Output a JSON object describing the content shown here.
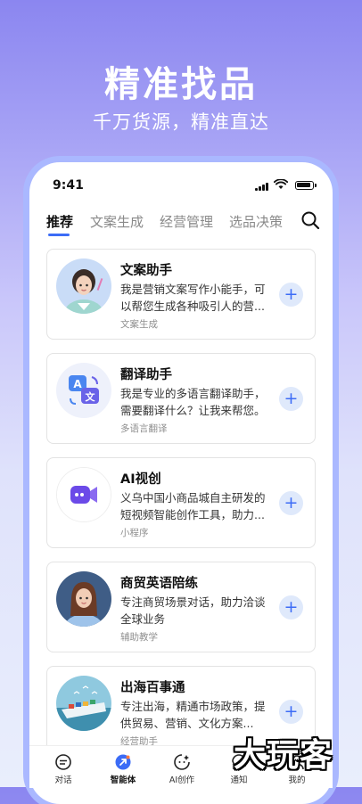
{
  "hero": {
    "title": "精准找品",
    "subtitle": "千万货源，精准直达"
  },
  "status_bar": {
    "time": "9:41"
  },
  "tabs": [
    {
      "label": "推荐",
      "active": true
    },
    {
      "label": "文案生成",
      "active": false
    },
    {
      "label": "经营管理",
      "active": false
    },
    {
      "label": "选品决策",
      "active": false
    }
  ],
  "cards": [
    {
      "title": "文案助手",
      "desc1": "我是营销文案写作小能手，可",
      "desc2": "以帮您生成各种吸引人的营...",
      "tag": "文案生成",
      "icon": "woman-assistant-avatar"
    },
    {
      "title": "翻译助手",
      "desc1": "我是专业的多语言翻译助手，",
      "desc2": "需要翻译什么？让我来帮您。",
      "tag": "多语言翻译",
      "icon": "translate-icon"
    },
    {
      "title": "AI视创",
      "desc1": "义乌中国小商品城自主研发的",
      "desc2": "短视频智能创作工具，助力...",
      "tag": "小程序",
      "icon": "video-camera-icon"
    },
    {
      "title": "商贸英语陪练",
      "desc1": "专注商贸场景对话，助力洽谈",
      "desc2": "全球业务",
      "tag": "辅助教学",
      "icon": "woman-tutor-avatar"
    },
    {
      "title": "出海百事通",
      "desc1": "专注出海，精通市场政策，提",
      "desc2": "供贸易、营销、文化方案...",
      "tag": "经营助手",
      "icon": "cargo-ship-image"
    }
  ],
  "add_label": "+",
  "bottom_nav": [
    {
      "label": "对话",
      "icon": "chat-icon",
      "active": false
    },
    {
      "label": "智能体",
      "icon": "agent-icon",
      "active": true
    },
    {
      "label": "AI创作",
      "icon": "ai-create-icon",
      "active": false
    },
    {
      "label": "通知",
      "icon": "notification-icon",
      "active": false
    },
    {
      "label": "我的",
      "icon": "profile-icon",
      "active": false
    }
  ],
  "watermark": "大玩客",
  "colors": {
    "accent": "#3c6cf6",
    "hero_gradient_top": "#8b86f0"
  }
}
